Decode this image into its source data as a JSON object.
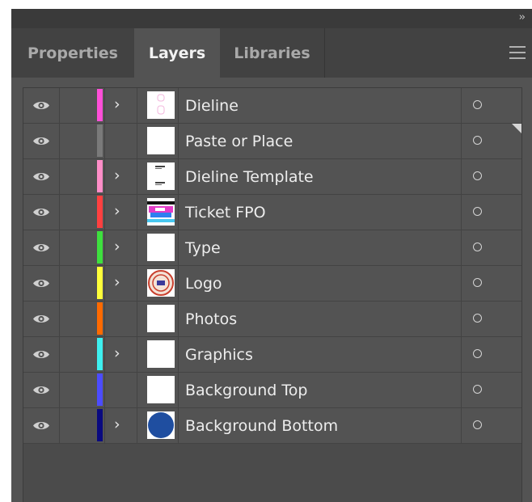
{
  "panel": {
    "collapse_glyph": "››",
    "tabs": [
      {
        "label": "Properties",
        "active": false
      },
      {
        "label": "Layers",
        "active": true
      },
      {
        "label": "Libraries",
        "active": false
      }
    ]
  },
  "layers": [
    {
      "name": "Dieline",
      "color": "#ff4fd8",
      "expandable": true,
      "thumbnail": "dieline-thumb"
    },
    {
      "name": "Paste or Place",
      "color": "#7a7a7a",
      "expandable": false,
      "thumbnail": "blank-thumb"
    },
    {
      "name": "Dieline Template",
      "color": "#ff8ec8",
      "expandable": true,
      "thumbnail": "template-thumb"
    },
    {
      "name": "Ticket FPO",
      "color": "#ff4040",
      "expandable": true,
      "thumbnail": "ticket-thumb"
    },
    {
      "name": "Type",
      "color": "#3ee03e",
      "expandable": true,
      "thumbnail": "blank-thumb"
    },
    {
      "name": "Logo",
      "color": "#ffff3a",
      "expandable": true,
      "thumbnail": "logo-thumb"
    },
    {
      "name": "Photos",
      "color": "#ff6a00",
      "expandable": false,
      "thumbnail": "blank-thumb"
    },
    {
      "name": "Graphics",
      "color": "#3ef0f0",
      "expandable": true,
      "thumbnail": "blank-thumb"
    },
    {
      "name": "Background Top",
      "color": "#4c4cff",
      "expandable": false,
      "thumbnail": "blank-thumb"
    },
    {
      "name": "Background Bottom",
      "color": "#0a0a80",
      "expandable": true,
      "thumbnail": "circle-thumb"
    }
  ],
  "glyphs": {
    "chevron": "›"
  },
  "colors": {
    "panel_bg": "#535353",
    "tab_bar_bg": "#424242",
    "active_tab_text": "#f2f2f2",
    "inactive_tab_text": "#a9a9a9"
  }
}
